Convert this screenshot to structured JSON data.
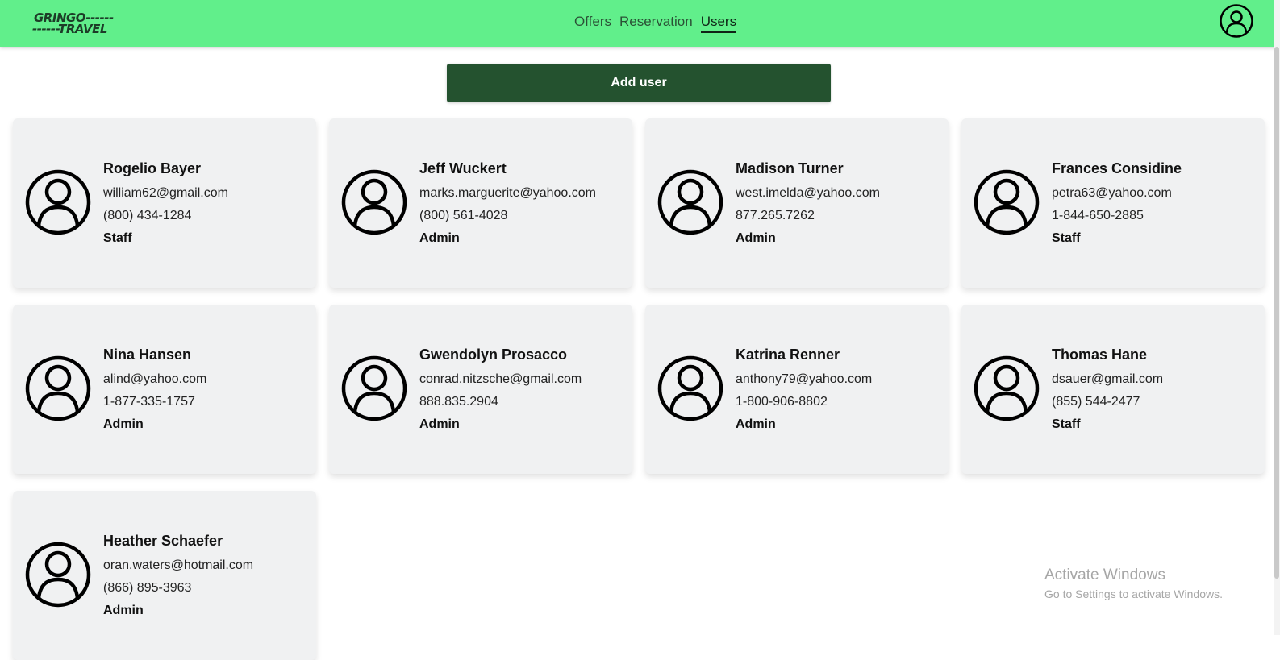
{
  "header": {
    "logo": {
      "line1": "GRINGO------",
      "line2": "------TRAVEL"
    },
    "nav": [
      {
        "label": "Offers",
        "active": false
      },
      {
        "label": "Reservation",
        "active": false
      },
      {
        "label": "Users",
        "active": true
      }
    ],
    "account_icon": "user-circle-icon"
  },
  "actions": {
    "add_user_label": "Add user"
  },
  "users": [
    {
      "name": "Rogelio Bayer",
      "email": "william62@gmail.com",
      "phone": "(800) 434-1284",
      "role": "Staff"
    },
    {
      "name": "Jeff Wuckert",
      "email": "marks.marguerite@yahoo.com",
      "phone": "(800) 561-4028",
      "role": "Admin"
    },
    {
      "name": "Madison Turner",
      "email": "west.imelda@yahoo.com",
      "phone": "877.265.7262",
      "role": "Admin"
    },
    {
      "name": "Frances Considine",
      "email": "petra63@yahoo.com",
      "phone": "1-844-650-2885",
      "role": "Staff"
    },
    {
      "name": "Nina Hansen",
      "email": "alind@yahoo.com",
      "phone": "1-877-335-1757",
      "role": "Admin"
    },
    {
      "name": "Gwendolyn Prosacco",
      "email": "conrad.nitzsche@gmail.com",
      "phone": "888.835.2904",
      "role": "Admin"
    },
    {
      "name": "Katrina Renner",
      "email": "anthony79@yahoo.com",
      "phone": "1-800-906-8802",
      "role": "Admin"
    },
    {
      "name": "Thomas Hane",
      "email": "dsauer@gmail.com",
      "phone": "(855) 544-2477",
      "role": "Staff"
    },
    {
      "name": "Heather Schaefer",
      "email": "oran.waters@hotmail.com",
      "phone": "(866) 895-3963",
      "role": "Admin"
    }
  ],
  "watermark": {
    "title": "Activate Windows",
    "subtitle": "Go to Settings to activate Windows."
  },
  "colors": {
    "header_bg": "#61ef8b",
    "button_bg": "#24522f",
    "card_bg": "#f0f1f2"
  }
}
